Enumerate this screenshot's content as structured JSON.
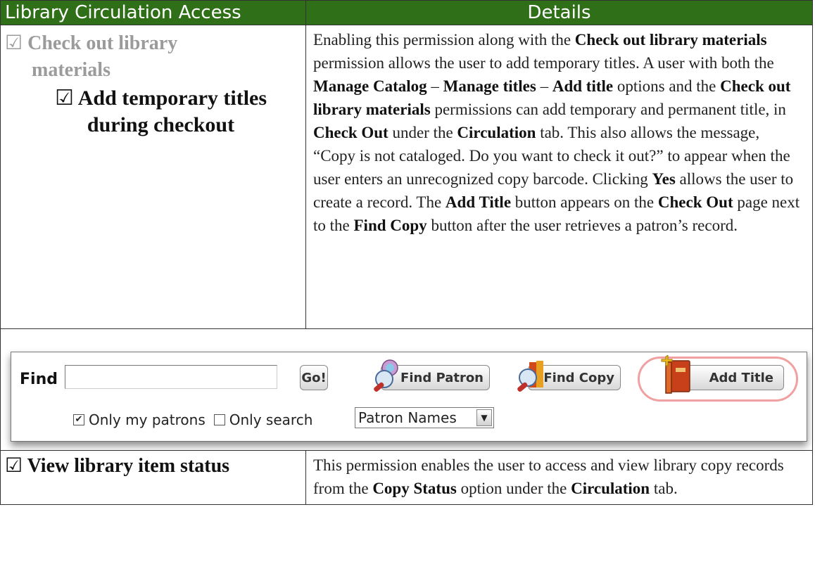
{
  "header": {
    "left": "Library Circulation Access",
    "right": "Details"
  },
  "row1": {
    "parent_check": "☑",
    "parent_line1": "Check out library",
    "parent_line2": "materials",
    "child_check": "☑",
    "child_line1": "Add temporary titles",
    "child_line2": "during checkout"
  },
  "row1_desc": {
    "t1": "Enabling this permission along with the ",
    "b1": "Check out library materials",
    "t2": " permission allows the user to add temporary titles. A user with both the ",
    "b2": "Manage Catalog",
    "t3": " – ",
    "b3": "Manage titles",
    "t4": " – ",
    "b4": "Add title",
    "t5": " options and the ",
    "b5": "Check out library materials",
    "t6": " permissions can add temporary and permanent title, in ",
    "b6": "Check Out",
    "t7": " under the ",
    "b7": "Circulation",
    "t8": " tab. This also allows the message, “Copy is not cataloged. Do you want to check it out?” to appear when the user enters an unrecognized copy barcode. Clicking ",
    "b8": "Yes",
    "t9": " allows the user to create a record. The ",
    "b9": "Add Title",
    "t10": " button appears on the ",
    "b10": "Check Out",
    "t11": " page next to the ",
    "b11": "Find Copy",
    "t12": " button after the user retrieves a patron’s record."
  },
  "screenshot": {
    "find_label": "Find",
    "find_value": "",
    "go_label": "Go!",
    "find_patron_label": "Find Patron",
    "find_copy_label": "Find Copy",
    "add_title_label": "Add Title",
    "only_my_patrons_label": "Only my patrons",
    "only_my_patrons_checked": "✔",
    "only_search_label": "Only search",
    "search_select_value": "Patron Names",
    "select_arrow": "▼"
  },
  "row3": {
    "check": "☑",
    "label": "View library item status"
  },
  "row3_desc": {
    "t1": "This permission enables the user to access and view library copy records from the ",
    "b1": "Copy Status",
    "t2": " option under the ",
    "b2": "Circulation",
    "t3": " tab."
  }
}
